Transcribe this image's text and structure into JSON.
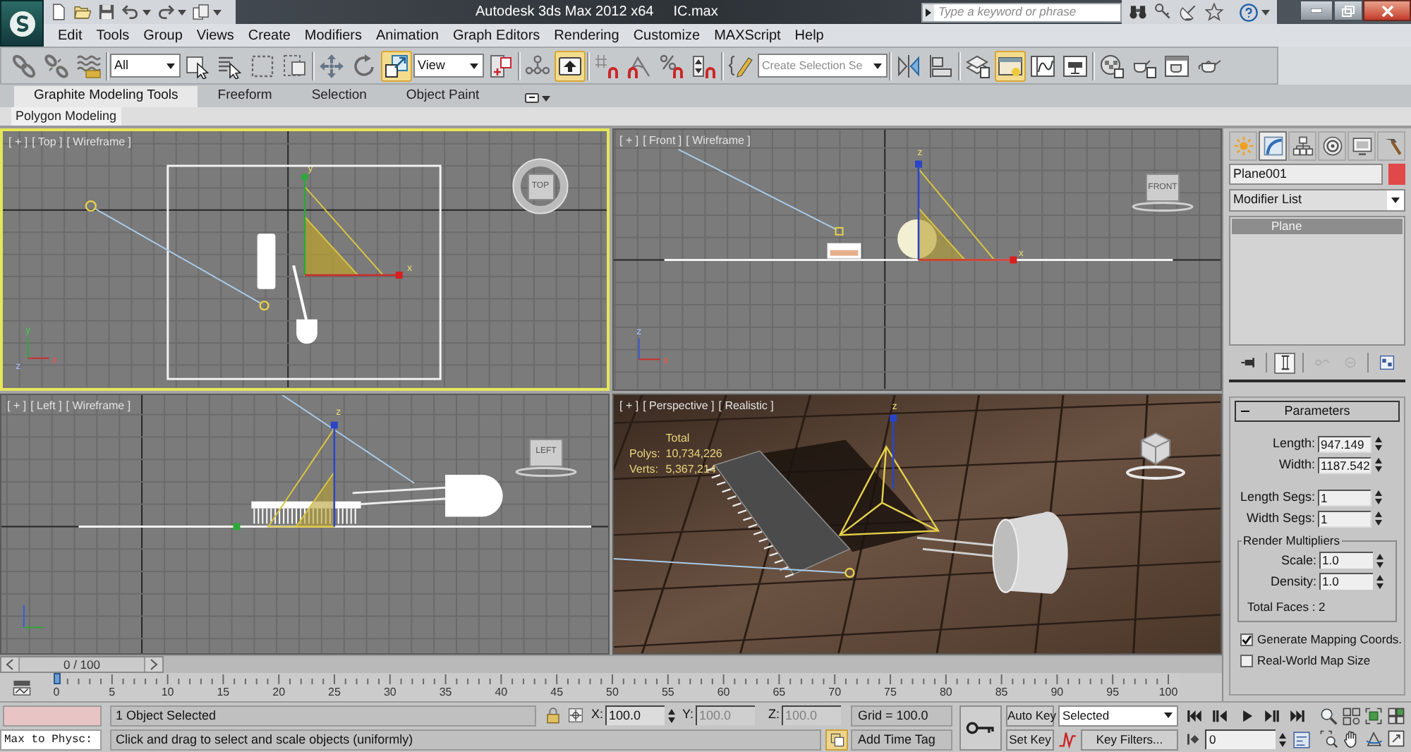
{
  "title_bar": {
    "title": "Autodesk 3ds Max 2012 x64",
    "file": "IC.max",
    "search": {
      "placeholder": "Type a keyword or phrase"
    }
  },
  "menu": [
    "Edit",
    "Tools",
    "Group",
    "Views",
    "Create",
    "Modifiers",
    "Animation",
    "Graph Editors",
    "Rendering",
    "Customize",
    "MAXScript",
    "Help"
  ],
  "main_toolbar": [
    [
      {
        "kind": "link",
        "on": false
      },
      {
        "kind": "unlink",
        "on": false
      },
      {
        "kind": "bind",
        "on": false
      }
    ],
    [
      {
        "kind": "filter",
        "value": "All"
      },
      {
        "kind": "select",
        "on": false
      },
      {
        "kind": "byname",
        "on": false
      },
      {
        "kind": "region",
        "on": false
      },
      {
        "kind": "crossing",
        "on": false
      }
    ],
    [
      {
        "kind": "move",
        "on": false
      },
      {
        "kind": "rotate",
        "on": false
      },
      {
        "kind": "scale",
        "on": true
      },
      {
        "kind": "coords",
        "value": "View"
      },
      {
        "kind": "pivot",
        "on": false
      }
    ],
    [
      {
        "kind": "manipulate",
        "on": false
      },
      {
        "kind": "shortcut",
        "on": true
      }
    ],
    [
      {
        "kind": "snap",
        "on": false
      },
      {
        "kind": "angle",
        "on": false
      },
      {
        "kind": "percent",
        "on": false
      },
      {
        "kind": "spinner",
        "on": false
      }
    ],
    [
      {
        "kind": "editnamed",
        "on": false
      },
      {
        "kind": "named",
        "placeholder": "Create Selection Se"
      }
    ],
    [
      {
        "kind": "mirror",
        "on": false
      },
      {
        "kind": "align",
        "on": false
      }
    ],
    [
      {
        "kind": "layers",
        "on": false
      },
      {
        "kind": "explorer",
        "on": true
      },
      {
        "kind": "curves",
        "on": false
      },
      {
        "kind": "schematic",
        "on": false
      }
    ],
    [
      {
        "kind": "material",
        "on": false
      },
      {
        "kind": "setup",
        "on": false
      },
      {
        "kind": "frame",
        "on": false
      },
      {
        "kind": "render",
        "on": false
      }
    ]
  ],
  "ribbon": {
    "tabs": [
      {
        "label": "Graphite Modeling Tools",
        "selected": true
      },
      {
        "label": "Freeform",
        "selected": false
      },
      {
        "label": "Selection",
        "selected": false
      },
      {
        "label": "Object Paint",
        "selected": false
      }
    ],
    "panels": [
      {
        "label": "Polygon Modeling",
        "selected": true
      }
    ]
  },
  "viewports": [
    {
      "kind": "top",
      "selected": true,
      "menu": [
        "[ + ]",
        "[ Top ]",
        "[ Wireframe ]"
      ],
      "viewcube": "TOP",
      "gizmo": [
        "y",
        "x"
      ],
      "tripod": [
        "y",
        "z",
        "x"
      ]
    },
    {
      "kind": "front",
      "selected": false,
      "menu": [
        "[ + ]",
        "[ Front ]",
        "[ Wireframe ]"
      ],
      "viewcube": "FRONT",
      "gizmo": [
        "z",
        "x"
      ],
      "tripod": [
        "z",
        "x"
      ]
    },
    {
      "kind": "left",
      "selected": false,
      "menu": [
        "[ + ]",
        "[ Left ]",
        "[ Wireframe ]"
      ],
      "viewcube": "LEFT",
      "gizmo": [
        "z"
      ]
    },
    {
      "kind": "perspective",
      "selected": false,
      "menu": [
        "[ + ]",
        "[ Perspective ]",
        "[ Realistic ]"
      ],
      "gizmo": [
        "z"
      ],
      "stats": {
        "title": "Total",
        "rows": [
          {
            "label": "Polys:",
            "value": "10,734,226"
          },
          {
            "label": "Verts:",
            "value": "5,367,214"
          }
        ]
      }
    }
  ],
  "time_slider": {
    "label": "0 / 100"
  },
  "track_bar": {
    "ticks": [
      "0",
      "5",
      "10",
      "15",
      "20",
      "25",
      "30",
      "35",
      "40",
      "45",
      "50",
      "55",
      "60",
      "65",
      "70",
      "75",
      "80",
      "85",
      "90",
      "95",
      "100"
    ],
    "level": 0
  },
  "command_panel": {
    "tabs": [
      {
        "kind": "create",
        "selected": false
      },
      {
        "kind": "modify",
        "selected": true
      },
      {
        "kind": "hierarchy",
        "selected": false
      },
      {
        "kind": "motion",
        "selected": false
      },
      {
        "kind": "display",
        "selected": false
      },
      {
        "kind": "utilities",
        "selected": false
      }
    ],
    "object": {
      "name": "Plane001",
      "color": "#e0484a"
    },
    "modifier_list": "Modifier List",
    "stack": [
      {
        "label": "Plane",
        "selected": true
      }
    ],
    "stack_buttons": [
      {
        "kind": "pin",
        "on": false,
        "disabled": false
      },
      {
        "kind": "endresult",
        "on": true,
        "disabled": false
      },
      {
        "kind": "unique",
        "on": false,
        "disabled": true
      },
      {
        "kind": "remove",
        "on": false,
        "disabled": true
      },
      {
        "kind": "configure",
        "on": false,
        "disabled": false
      }
    ],
    "rollout": {
      "title": "Parameters",
      "expanded": true,
      "size": [
        {
          "label": "Length:",
          "value": "947.149"
        },
        {
          "label": "Width:",
          "value": "1187.542"
        }
      ],
      "segments": [
        {
          "label": "Length Segs:",
          "value": "1"
        },
        {
          "label": "Width Segs:",
          "value": "1"
        }
      ],
      "render_multipliers": {
        "title": "Render Multipliers",
        "fields": [
          {
            "label": "Scale:",
            "value": "1.0"
          },
          {
            "label": "Density:",
            "value": "1.0"
          }
        ],
        "total": "Total Faces : 2"
      },
      "options": [
        {
          "label": "Generate Mapping Coords.",
          "checked": true
        },
        {
          "label": "Real-World Map Size",
          "checked": false
        }
      ]
    }
  },
  "status_bar": {
    "mini_listener": "Max to Physc:",
    "selection": "1 Object Selected",
    "prompt": "Click and drag to select and scale objects (uniformly)",
    "coords": [
      {
        "label": "X:",
        "value": "100.0",
        "disabled": false
      },
      {
        "label": "Y:",
        "value": "100.0",
        "disabled": true
      },
      {
        "label": "Z:",
        "value": "100.0",
        "disabled": true
      }
    ],
    "grid": "Grid = 100.0",
    "time_tag": "Add Time Tag",
    "auto_key": {
      "label": "Auto Key",
      "on": false
    },
    "key_set": "Selected",
    "set_key": "Set Key",
    "key_filters": "Key Filters...",
    "frame": "0"
  }
}
